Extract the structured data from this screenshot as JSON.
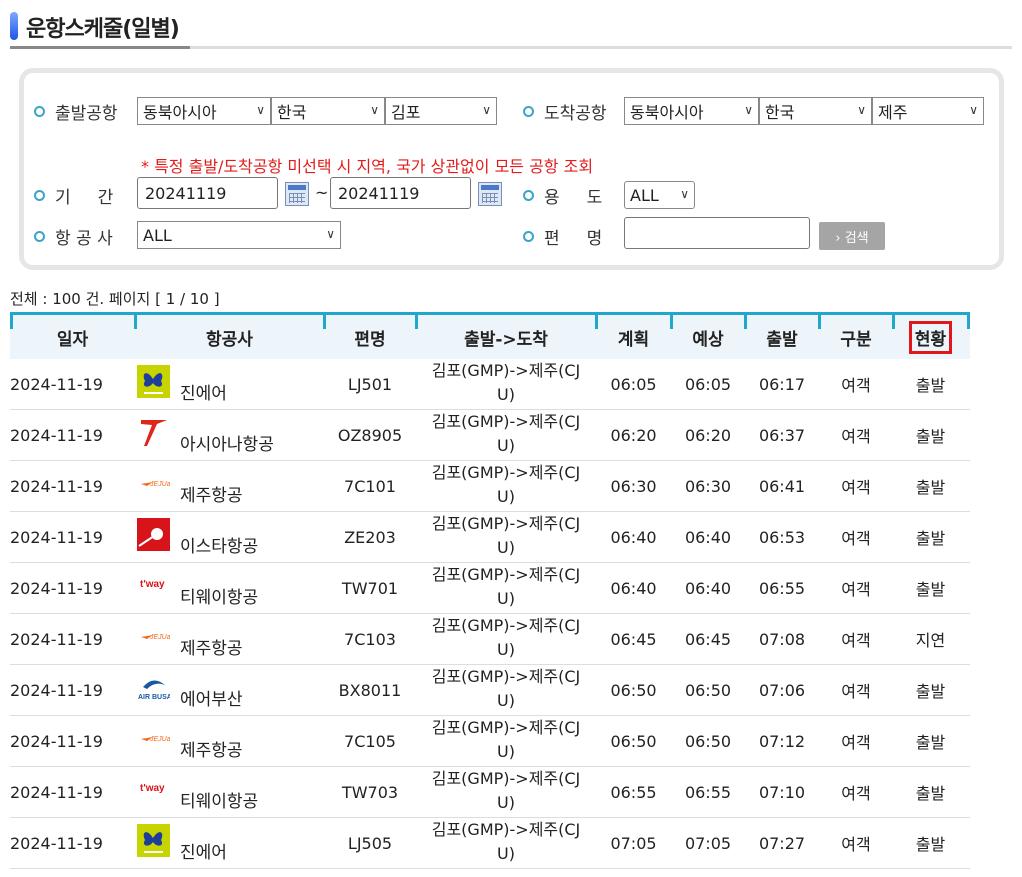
{
  "page_title": "운항스케줄(일별)",
  "search": {
    "departure_label": "출발공항",
    "departure": {
      "region": "동북아시아",
      "country": "한국",
      "airport": "김포"
    },
    "arrival_label": "도착공항",
    "arrival": {
      "region": "동북아시아",
      "country": "한국",
      "airport": "제주"
    },
    "notice": "* 특정 출발/도착공항 미선택 시 지역, 국가 상관없이 모든 공항 조회",
    "period_label": "기     간",
    "date_from": "20241119",
    "date_sep": "~",
    "date_to": "20241119",
    "purpose_label": "용     도",
    "purpose": "ALL",
    "airline_label": "항 공 사",
    "airline": "ALL",
    "flight_label": "편     명",
    "flight_value": "",
    "search_button": "› 검색"
  },
  "summary": "전체 : 100 건. 페이지 [ 1 / 10 ]",
  "table": {
    "headers": [
      "일자",
      "항공사",
      "편명",
      "출발->도착",
      "계획",
      "예상",
      "출발",
      "구분",
      "현황"
    ],
    "rows": [
      {
        "date": "2024-11-19",
        "logo": "jinair-logo",
        "airline": "진에어",
        "flight": "LJ501",
        "route_1": "김포(GMP)->제주(CJ",
        "route_2": "U)",
        "plan": "06:05",
        "est": "06:05",
        "dep": "06:17",
        "type": "여객",
        "status": "출발"
      },
      {
        "date": "2024-11-19",
        "logo": "asiana-logo",
        "airline": "아시아나항공",
        "flight": "OZ8905",
        "route_1": "김포(GMP)->제주(CJ",
        "route_2": "U)",
        "plan": "06:20",
        "est": "06:20",
        "dep": "06:37",
        "type": "여객",
        "status": "출발"
      },
      {
        "date": "2024-11-19",
        "logo": "jejuair-logo",
        "airline": "제주항공",
        "flight": "7C101",
        "route_1": "김포(GMP)->제주(CJ",
        "route_2": "U)",
        "plan": "06:30",
        "est": "06:30",
        "dep": "06:41",
        "type": "여객",
        "status": "출발"
      },
      {
        "date": "2024-11-19",
        "logo": "eastarjet-logo",
        "airline": "이스타항공",
        "flight": "ZE203",
        "route_1": "김포(GMP)->제주(CJ",
        "route_2": "U)",
        "plan": "06:40",
        "est": "06:40",
        "dep": "06:53",
        "type": "여객",
        "status": "출발"
      },
      {
        "date": "2024-11-19",
        "logo": "tway-logo",
        "airline": "티웨이항공",
        "flight": "TW701",
        "route_1": "김포(GMP)->제주(CJ",
        "route_2": "U)",
        "plan": "06:40",
        "est": "06:40",
        "dep": "06:55",
        "type": "여객",
        "status": "출발"
      },
      {
        "date": "2024-11-19",
        "logo": "jejuair-logo",
        "airline": "제주항공",
        "flight": "7C103",
        "route_1": "김포(GMP)->제주(CJ",
        "route_2": "U)",
        "plan": "06:45",
        "est": "06:45",
        "dep": "07:08",
        "type": "여객",
        "status": "지연"
      },
      {
        "date": "2024-11-19",
        "logo": "airbusan-logo",
        "airline": "에어부산",
        "flight": "BX8011",
        "route_1": "김포(GMP)->제주(CJ",
        "route_2": "U)",
        "plan": "06:50",
        "est": "06:50",
        "dep": "07:06",
        "type": "여객",
        "status": "출발"
      },
      {
        "date": "2024-11-19",
        "logo": "jejuair-logo",
        "airline": "제주항공",
        "flight": "7C105",
        "route_1": "김포(GMP)->제주(CJ",
        "route_2": "U)",
        "plan": "06:50",
        "est": "06:50",
        "dep": "07:12",
        "type": "여객",
        "status": "출발"
      },
      {
        "date": "2024-11-19",
        "logo": "tway-logo",
        "airline": "티웨이항공",
        "flight": "TW703",
        "route_1": "김포(GMP)->제주(CJ",
        "route_2": "U)",
        "plan": "06:55",
        "est": "06:55",
        "dep": "07:10",
        "type": "여객",
        "status": "출발"
      },
      {
        "date": "2024-11-19",
        "logo": "jinair-logo",
        "airline": "진에어",
        "flight": "LJ505",
        "route_1": "김포(GMP)->제주(CJ",
        "route_2": "U)",
        "plan": "07:05",
        "est": "07:05",
        "dep": "07:27",
        "type": "여객",
        "status": "출발"
      }
    ]
  },
  "colors": {
    "accent": "#21a6cc",
    "notice": "#e21b1b",
    "highlight": "#e0181c"
  }
}
